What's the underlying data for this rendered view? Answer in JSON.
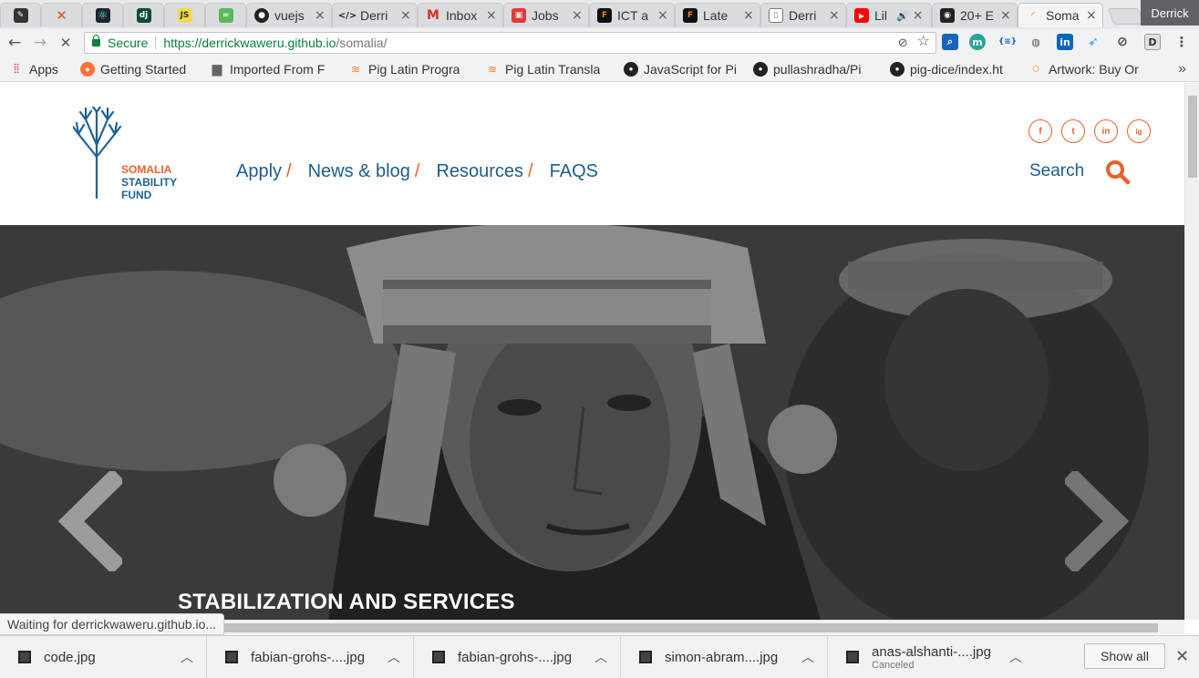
{
  "browser": {
    "tabs": [
      {
        "label": "",
        "icon": "pen-favicon-icon",
        "color": "#333333"
      },
      {
        "label": "",
        "icon": "x-favicon-icon",
        "color": "#e64a19"
      },
      {
        "label": "",
        "icon": "react-favicon-icon",
        "color": "#61dafb"
      },
      {
        "label": "dj",
        "icon": "django-favicon-icon",
        "color": "#0c4b33"
      },
      {
        "label": "JS",
        "icon": "js-favicon-icon",
        "color": "#f0db4f"
      },
      {
        "label": "",
        "icon": "code-favicon-icon",
        "color": "#5cb85c"
      },
      {
        "label": "vuejs",
        "icon": "github-favicon-icon",
        "color": "#222222"
      },
      {
        "label": "Derri",
        "icon": "code-tag-favicon-icon",
        "color": "#222222"
      },
      {
        "label": "Inbox",
        "icon": "gmail-favicon-icon",
        "color": "#d93025"
      },
      {
        "label": "Jobs",
        "icon": "jobs-favicon-icon",
        "color": "#e53935"
      },
      {
        "label": "ICT a",
        "icon": "ict-favicon-icon",
        "color": "#f57c00"
      },
      {
        "label": "Late",
        "icon": "ict-favicon-icon",
        "color": "#f57c00"
      },
      {
        "label": "Derri",
        "icon": "document-favicon-icon",
        "color": "#777777"
      },
      {
        "label": "Lil",
        "icon": "youtube-favicon-icon",
        "color": "#ff0000"
      },
      {
        "label": "20+ E",
        "icon": "camera-favicon-icon",
        "color": "#222222"
      },
      {
        "label": "Soma",
        "icon": "loading-favicon-icon",
        "color": "#e8612c"
      }
    ],
    "profile_name": "Derrick",
    "secure_label": "Secure",
    "url_scheme_host": "https://derrickwaweru.github.io",
    "url_path": "/somalia/",
    "bookmarks": [
      {
        "label": "Apps",
        "icon": "apps-grid-icon"
      },
      {
        "label": "Getting Started",
        "icon": "firefox-icon"
      },
      {
        "label": "Imported From F",
        "icon": "folder-icon"
      },
      {
        "label": "Pig Latin Progra",
        "icon": "stackoverflow-icon"
      },
      {
        "label": "Pig Latin Transla",
        "icon": "stackoverflow-icon"
      },
      {
        "label": "JavaScript for Pi",
        "icon": "github-icon"
      },
      {
        "label": "pullashradha/Pi",
        "icon": "github-icon"
      },
      {
        "label": "pig-dice/index.ht",
        "icon": "github-icon"
      },
      {
        "label": "Artwork: Buy Or",
        "icon": "artwork-ring-icon"
      }
    ],
    "status_text": "Waiting for derrickwaweru.github.io..."
  },
  "site": {
    "logo": {
      "line1": "SOMALIA",
      "line2": "STABILITY",
      "line3": "FUND"
    },
    "nav": [
      {
        "label": "Apply"
      },
      {
        "label": "News & blog"
      },
      {
        "label": "Resources"
      },
      {
        "label": "FAQS"
      }
    ],
    "socials": [
      "f",
      "t",
      "in",
      "ig"
    ],
    "search_label": "Search",
    "hero_caption": "STABILIZATION AND SERVICES",
    "colors": {
      "accent": "#e8612c",
      "brand_blue": "#1d5c8f"
    }
  },
  "downloads": {
    "items": [
      {
        "name": "code.jpg",
        "sub": ""
      },
      {
        "name": "fabian-grohs-....jpg",
        "sub": ""
      },
      {
        "name": "fabian-grohs-....jpg",
        "sub": ""
      },
      {
        "name": "simon-abram....jpg",
        "sub": ""
      },
      {
        "name": "anas-alshanti-....jpg",
        "sub": "Canceled"
      }
    ],
    "show_all_label": "Show all"
  }
}
